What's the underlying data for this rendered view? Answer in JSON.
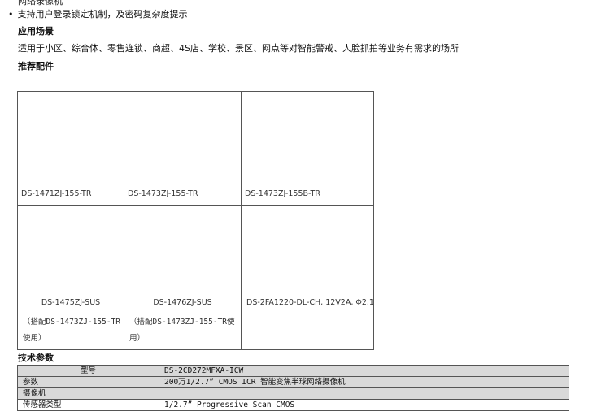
{
  "top_cut_text": "网络录像机           ",
  "features": {
    "bullet_char": "•",
    "last_item": "支持用户登录锁定机制，及密码复杂度提示"
  },
  "scene": {
    "heading": "应用场景",
    "text": "适用于小区、综合体、零售连锁、商超、4S店、学校、景区、网点等对智能警戒、人脸抓拍等业务有需求的场所"
  },
  "accessories": {
    "heading": "推荐配件",
    "items": [
      {
        "model": "DS-1471ZJ-155-TR",
        "note1": "",
        "note2": ""
      },
      {
        "model": "DS-1473ZJ-155-TR",
        "note1": "",
        "note2": ""
      },
      {
        "model": "DS-1473ZJ-155B-TR",
        "note1": "",
        "note2": ""
      },
      {
        "model": "DS-1475ZJ-SUS",
        "note1": "（搭配DS-1473ZJ-155-TR",
        "note2": "使用）"
      },
      {
        "model": "DS-1476ZJ-SUS",
        "note1": "（搭配DS-1473ZJ-155-TR使",
        "note2": "用）"
      },
      {
        "model": "DS-2FA1220-DL-CH, 12V2A, Φ2.1",
        "note1": "",
        "note2": ""
      }
    ]
  },
  "specs": {
    "heading": "技术参数",
    "model_label": "型号",
    "model_value": "DS-2CD272MFXA-ICW",
    "param_label": "参数",
    "param_value": "200万1/2.7” CMOS ICR 智能变焦半球网络摄像机",
    "section_camera": "摄像机",
    "sensor_label": "传感器类型",
    "sensor_value": "1/2.7”  Progressive Scan CMOS"
  }
}
